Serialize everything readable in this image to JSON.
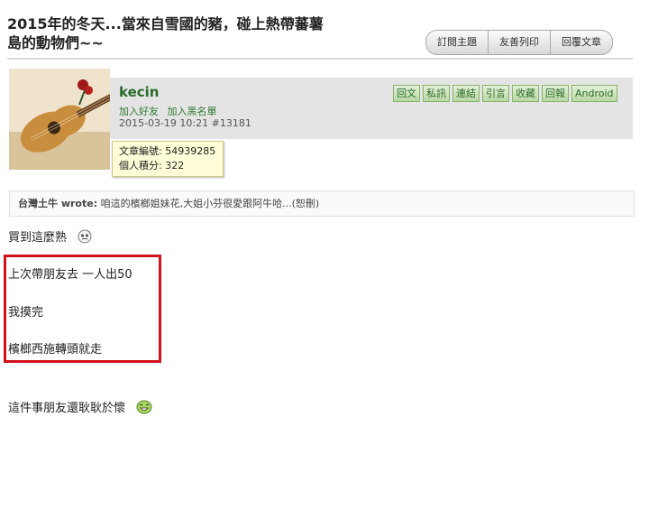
{
  "thread": {
    "title_line1": "2015年的冬天...當來自雪國的豬，碰上熱帶蕃薯",
    "title_line2": "島的動物們~~"
  },
  "toolbar": {
    "subscribe_label": "訂閱主題",
    "print_label": "友善列印",
    "reply_label": "回覆文章"
  },
  "post": {
    "username": "kecin",
    "add_friend_label": "加入好友",
    "add_blacklist_label": "加入黑名單",
    "timestamp": "2015-03-19 10:21",
    "post_number": "#13181",
    "actions": [
      "回文",
      "私訊",
      "連結",
      "引言",
      "收藏",
      "回報",
      "Android"
    ],
    "tooltip": {
      "article_id_label": "文章編號:",
      "article_id": "54939285",
      "points_label": "個人積分:",
      "points": "322"
    },
    "quote": {
      "author": "台灣土牛 wrote:",
      "text": "咱這的檳榔姐妹花,大姐小芬很愛跟阿牛哈...(恕刪)"
    },
    "body": {
      "line1": "買到這麼熟",
      "line2": "上次帶朋友去 一人出50",
      "line3": "我摸完",
      "line4": "檳榔西施轉頭就走",
      "line5": "這件事朋友還耿耿於懷"
    }
  },
  "colors": {
    "highlight_box": "#d0121b",
    "username": "#2a6b2a",
    "action_button": "#b9d8a4",
    "tooltip_bg": "#fefdd8"
  },
  "icons": [
    "sweat-smiley-icon",
    "laughing-smiley-icon"
  ]
}
